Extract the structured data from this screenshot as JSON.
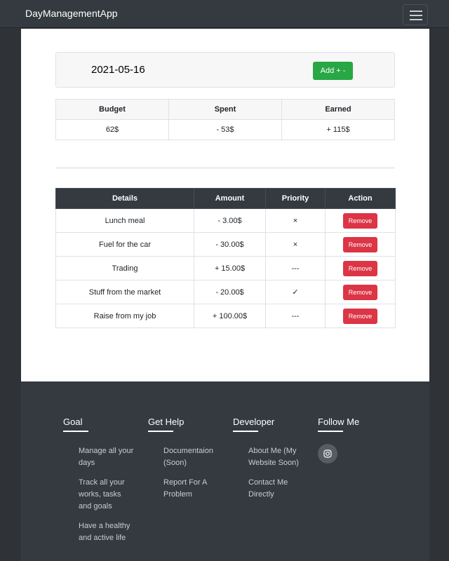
{
  "navbar": {
    "brand": "DayManagementApp",
    "menu_icon": "hamburger-menu-icon"
  },
  "header": {
    "date": "2021-05-16",
    "add_button_label": "Add + -"
  },
  "summary": {
    "columns": [
      "Budget",
      "Spent",
      "Earned"
    ],
    "values": [
      "62$",
      "- 53$",
      "+ 115$"
    ]
  },
  "transactions": {
    "columns": [
      "Details",
      "Amount",
      "Priority",
      "Action"
    ],
    "rows": [
      {
        "details": "Lunch meal",
        "amount": "- 3.00$",
        "priority": "×",
        "action": "Remove"
      },
      {
        "details": "Fuel for the car",
        "amount": "- 30.00$",
        "priority": "×",
        "action": "Remove"
      },
      {
        "details": "Trading",
        "amount": "+ 15.00$",
        "priority": "---",
        "action": "Remove"
      },
      {
        "details": "Stuff from the market",
        "amount": "- 20.00$",
        "priority": "✓",
        "action": "Remove"
      },
      {
        "details": "Raise from my job",
        "amount": "+ 100.00$",
        "priority": "---",
        "action": "Remove"
      }
    ]
  },
  "footer": {
    "goal": {
      "title": "Goal",
      "items": [
        "Manage all your days",
        "Track all your works, tasks and goals",
        "Have a healthy and active life"
      ]
    },
    "help": {
      "title": "Get Help",
      "items": [
        "Documentaion (Soon)",
        "Report For A Problem"
      ]
    },
    "developer": {
      "title": "Developer",
      "items": [
        "About Me (My Website Soon)",
        "Contact Me Directly"
      ]
    },
    "follow": {
      "title": "Follow Me",
      "icon": "instagram-icon"
    }
  },
  "colors": {
    "negative": "#dc3545",
    "positive": "#28a745",
    "dark": "#343a40"
  }
}
